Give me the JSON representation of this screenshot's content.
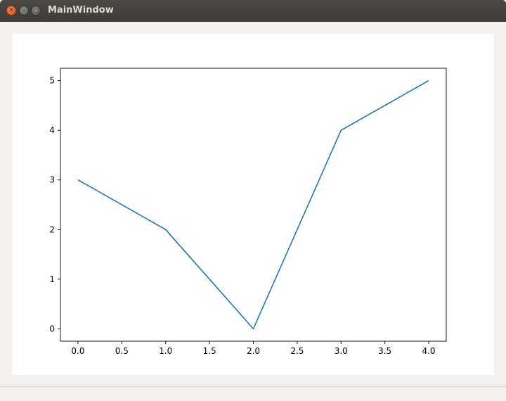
{
  "window": {
    "title": "MainWindow",
    "close_icon": "close-icon",
    "minimize_icon": "minimize-icon",
    "maximize_icon": "maximize-icon"
  },
  "chart_data": {
    "type": "line",
    "x": [
      0,
      1,
      2,
      3,
      4
    ],
    "series": [
      {
        "values": [
          3,
          2,
          0,
          4,
          5
        ],
        "color": "#1f77b4"
      }
    ],
    "xlim": [
      -0.2,
      4.2
    ],
    "ylim": [
      -0.25,
      5.25
    ],
    "xticks": [
      0.0,
      0.5,
      1.0,
      1.5,
      2.0,
      2.5,
      3.0,
      3.5,
      4.0
    ],
    "xtick_labels": [
      "0.0",
      "0.5",
      "1.0",
      "1.5",
      "2.0",
      "2.5",
      "3.0",
      "3.5",
      "4.0"
    ],
    "yticks": [
      0,
      1,
      2,
      3,
      4,
      5
    ],
    "ytick_labels": [
      "0",
      "1",
      "2",
      "3",
      "4",
      "5"
    ],
    "grid": false,
    "legend": "none"
  }
}
